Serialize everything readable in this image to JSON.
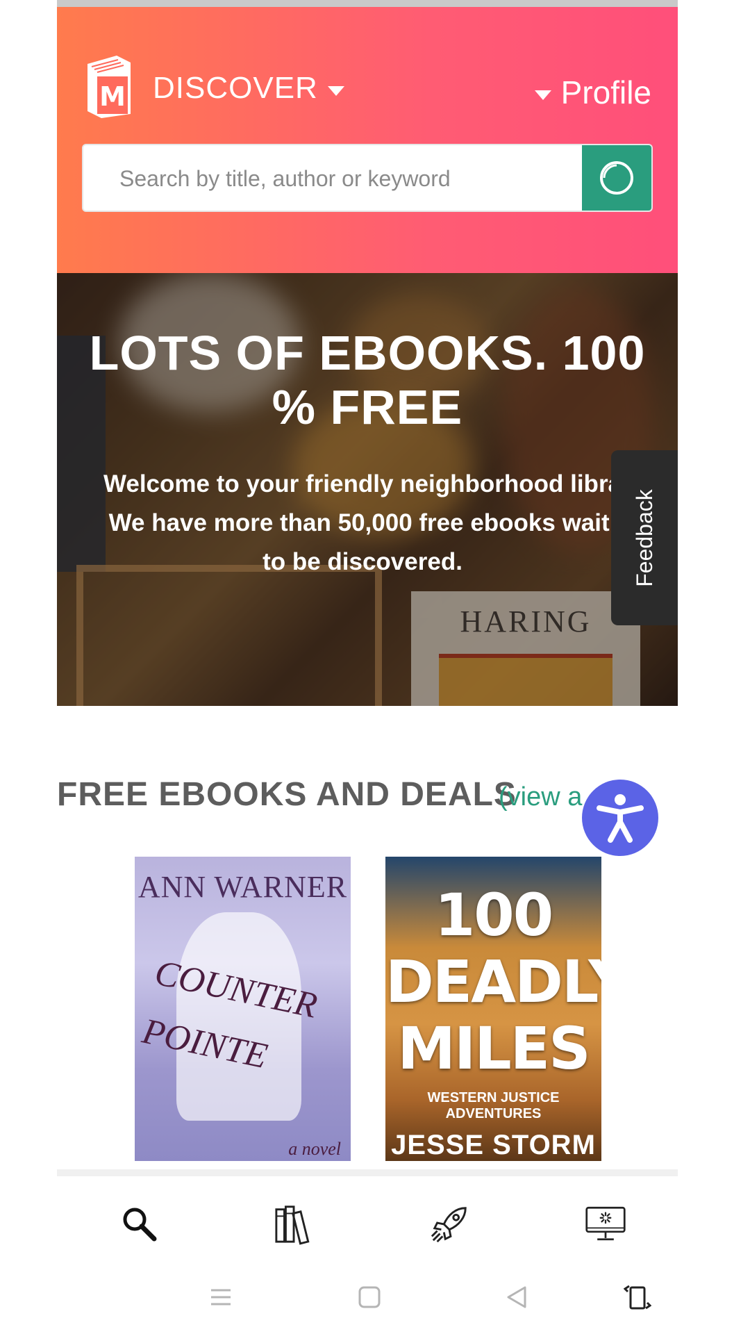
{
  "header": {
    "discover_label": "DISCOVER",
    "profile_label": "Profile"
  },
  "search": {
    "placeholder": "Search by title, author or keyword",
    "value": ""
  },
  "banner": {
    "title": "LOTS OF EBOOKS. 100 % FREE",
    "text_line1": "Welcome to your friendly neighborhood libra",
    "text_line2": "We have more than 50,000 free ebooks waiti",
    "text_line3": "to be discovered.",
    "haring_title": "HARING"
  },
  "feedback": {
    "label": "Feedback"
  },
  "section": {
    "title": "FREE EBOOKS AND DEALS",
    "view_all": "(view a"
  },
  "books": [
    {
      "author": "ANN WARNER",
      "title_line1": "COUNTER",
      "title_line2": "POINTE",
      "subtitle": "a novel"
    },
    {
      "title_line1": "100",
      "title_line2": "DEADLY",
      "title_line3": "MILES",
      "series": "WESTERN JUSTICE ADVENTURES",
      "author": "JESSE STORM"
    }
  ],
  "tabbar": {
    "items": [
      {
        "icon": "search-icon"
      },
      {
        "icon": "books-icon"
      },
      {
        "icon": "rocket-icon"
      },
      {
        "icon": "monitor-icon"
      }
    ]
  },
  "colors": {
    "header_gradient_start": "#ff7b4d",
    "header_gradient_end": "#ff4f7a",
    "accent_green": "#2a9d7e",
    "accessibility_blue": "#5b63e6"
  }
}
